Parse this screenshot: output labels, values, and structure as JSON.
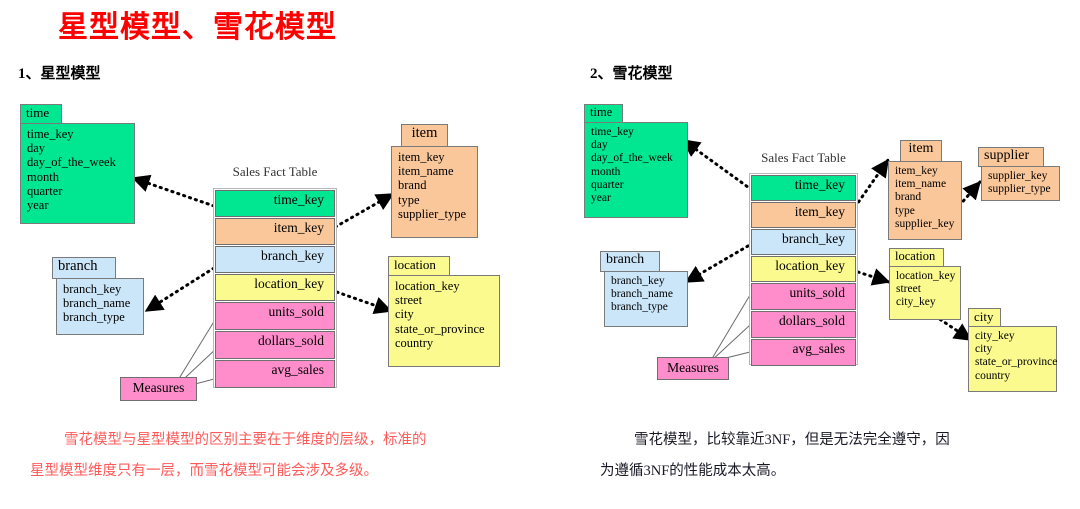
{
  "page": {
    "title": "星型模型、雪花模型",
    "section_left": "1、星型模型",
    "section_right": "2、雪花模型"
  },
  "colors": {
    "title": "#ff0000",
    "time": "#00E691",
    "item": "#FAC79A",
    "branch": "#CBE6F9",
    "location": "#FAFA8F",
    "measures": "#FF8CCB",
    "caption_left": "#ff5a5a",
    "caption_right": "#1a1a26"
  },
  "star": {
    "fact": {
      "caption": "Sales Fact Table",
      "rows": [
        "time_key",
        "item_key",
        "branch_key",
        "location_key",
        "units_sold",
        "dollars_sold",
        "avg_sales"
      ]
    },
    "measures_label": "Measures",
    "tables": {
      "time": {
        "name": "time",
        "fields": [
          "time_key",
          "day",
          "day_of_the_week",
          "month",
          "quarter",
          "year"
        ]
      },
      "branch": {
        "name": "branch",
        "fields": [
          "branch_key",
          "branch_name",
          "branch_type"
        ]
      },
      "item": {
        "name": "item",
        "fields": [
          "item_key",
          "item_name",
          "brand",
          "type",
          "supplier_type"
        ]
      },
      "location": {
        "name": "location",
        "fields": [
          "location_key",
          "street",
          "city",
          "state_or_province",
          "country"
        ]
      }
    }
  },
  "snowflake": {
    "fact": {
      "caption": "Sales Fact Table",
      "rows": [
        "time_key",
        "item_key",
        "branch_key",
        "location_key",
        "units_sold",
        "dollars_sold",
        "avg_sales"
      ]
    },
    "measures_label": "Measures",
    "tables": {
      "time": {
        "name": "time",
        "fields": [
          "time_key",
          "day",
          "day_of_the_week",
          "month",
          "quarter",
          "year"
        ]
      },
      "branch": {
        "name": "branch",
        "fields": [
          "branch_key",
          "branch_name",
          "branch_type"
        ]
      },
      "item": {
        "name": "item",
        "fields": [
          "item_key",
          "item_name",
          "brand",
          "type",
          "supplier_key"
        ]
      },
      "supplier": {
        "name": "supplier",
        "fields": [
          "supplier_key",
          "supplier_type"
        ]
      },
      "location": {
        "name": "location",
        "fields": [
          "location_key",
          "street",
          "city_key"
        ]
      },
      "city": {
        "name": "city",
        "fields": [
          "city_key",
          "city",
          "state_or_province",
          "country"
        ]
      }
    }
  },
  "captions": {
    "left_line1": "雪花模型与星型模型的区别主要在于维度的层级，标准的",
    "left_line2": "星型模型维度只有一层，而雪花模型可能会涉及多级。",
    "right_line1": "雪花模型，比较靠近3NF，但是无法完全遵守，因",
    "right_line2": "为遵循3NF的性能成本太高。"
  }
}
